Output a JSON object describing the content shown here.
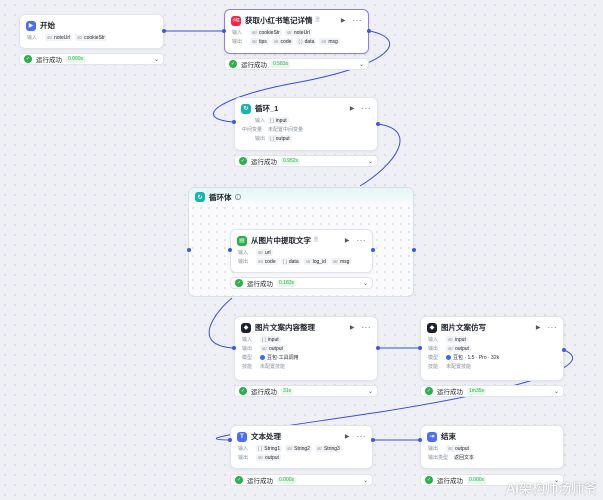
{
  "colors": {
    "wire": "#3b4fd8",
    "success": "#27b148",
    "start_icon": "#4c6ef5",
    "xhs_icon": "#ff2442",
    "loop_icon": "#15b5b0",
    "image_icon": "#27b148",
    "llm_icon": "#1d2129",
    "text_icon": "#4c6ef5",
    "end_icon": "#4c6ef5"
  },
  "nodes": {
    "start": {
      "title": "开始",
      "icon": "start-icon",
      "input_label": "输入",
      "chips": [
        {
          "type": "str",
          "name": "noteUrl"
        },
        {
          "type": "str",
          "name": "cookieStr"
        }
      ],
      "status": "运行成功",
      "time": "0.000s"
    },
    "xhs": {
      "title": "获取小红书笔记详情",
      "badge": "🗎",
      "input_label": "输入",
      "output_label": "输出",
      "inputs": [
        {
          "type": "str",
          "name": "cookieStr"
        },
        {
          "type": "str",
          "name": "noteUrl"
        }
      ],
      "outputs": [
        {
          "type": "str",
          "name": "tips"
        },
        {
          "type": "int",
          "name": "code"
        },
        {
          "type": "{ }",
          "name": "data"
        },
        {
          "type": "str",
          "name": "msg"
        }
      ],
      "status": "运行成功",
      "time": "0.583s"
    },
    "loop": {
      "title": "循环_1",
      "input_label": "输入",
      "mid_label": "中间变量",
      "output_label": "输出",
      "input": {
        "type": "[ ]",
        "name": "input"
      },
      "mid_value": "未配置中间变量",
      "output": {
        "type": "[ ]",
        "name": "output"
      },
      "status": "运行成功",
      "time": "0.952s"
    },
    "loop_body": {
      "title": "循环体",
      "info": "i"
    },
    "ocr": {
      "title": "从图片中提取文字",
      "badge": "🗎",
      "input_label": "输入",
      "output_label": "输出",
      "inputs": [
        {
          "type": "str",
          "name": "url"
        }
      ],
      "outputs": [
        {
          "type": "int",
          "name": "code"
        },
        {
          "type": "{ }",
          "name": "data"
        },
        {
          "type": "str",
          "name": "log_id"
        },
        {
          "type": "str",
          "name": "msg"
        }
      ],
      "status": "运行成功",
      "time": "0.183s"
    },
    "organize": {
      "title": "图片文案内容整理",
      "input_label": "输入",
      "output_label": "输出",
      "model_label": "模型",
      "skill_label": "技能",
      "input": {
        "type": "[ ]",
        "name": "input"
      },
      "output": {
        "type": "str",
        "name": "output"
      },
      "model": "豆包·工具调用",
      "skill": "未配置技能",
      "status": "运行成功",
      "time": "31s"
    },
    "imitate": {
      "title": "图片文案仿写",
      "input_label": "输入",
      "output_label": "输出",
      "model_label": "模型",
      "skill_label": "技能",
      "input": {
        "type": "str",
        "name": "input"
      },
      "output": {
        "type": "str",
        "name": "output"
      },
      "model": "豆包 · 1.5 · Pro · 32k",
      "skill": "未配置技能",
      "status": "运行成功",
      "time": "1m35s"
    },
    "text": {
      "title": "文本处理",
      "input_label": "输入",
      "output_label": "输出",
      "inputs": [
        {
          "type": "{ }",
          "name": "String1"
        },
        {
          "type": "str",
          "name": "String2"
        },
        {
          "type": "str",
          "name": "String3"
        }
      ],
      "output": {
        "type": "str",
        "name": "output"
      },
      "status": "运行成功",
      "time": "0.000s"
    },
    "end": {
      "title": "结束",
      "input_label": "输出",
      "answer_label": "输出类型",
      "output": {
        "type": "str",
        "name": "output"
      },
      "answer_type": "返回文本",
      "status": "运行成功",
      "time": "0.000s"
    }
  },
  "watermark": "AI架构师汤师爷"
}
